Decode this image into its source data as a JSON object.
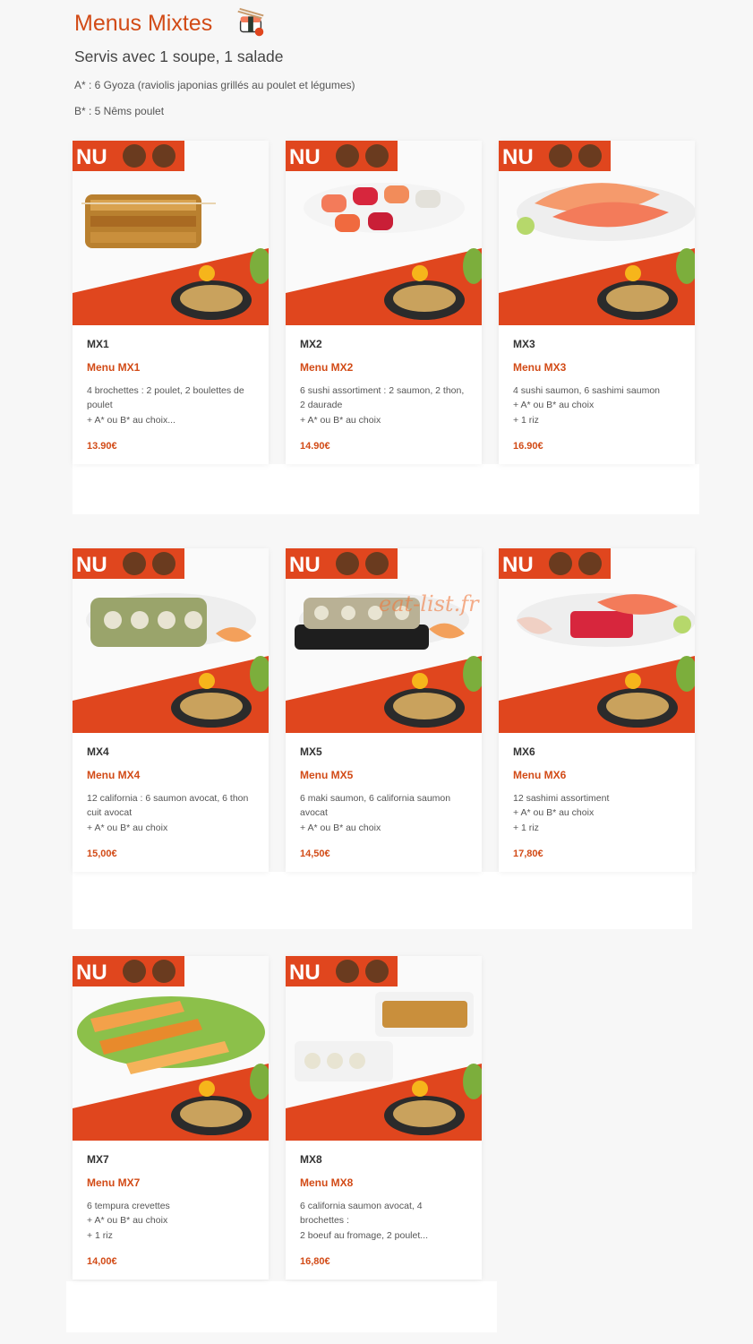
{
  "header": {
    "title": "Menus Mixtes",
    "subtitle": "Servis avec 1 soupe, 1 salade",
    "notes": [
      "A* : 6 Gyoza (raviolis japonias grillés au poulet et légumes)",
      "B* : 5 Nêms poulet"
    ],
    "icon": "sushi-icon"
  },
  "brand_badge": "NU",
  "colors": {
    "accent": "#d24b17",
    "background": "#f7f7f7",
    "card": "#ffffff",
    "banner_red": "#e0461e"
  },
  "menus": [
    {
      "code": "MX1",
      "name": "Menu MX1",
      "desc": [
        "4 brochettes : 2 poulet, 2 boulettes de poulet",
        "+ A* ou B* au choix..."
      ],
      "price": "13.90€",
      "food": "skewers-dish"
    },
    {
      "code": "MX2",
      "name": "Menu MX2",
      "desc": [
        "6 sushi assortiment : 2 saumon, 2 thon, 2 daurade",
        "+ A* ou B* au choix"
      ],
      "price": "14.90€",
      "food": "sushi-dish"
    },
    {
      "code": "MX3",
      "name": "Menu MX3",
      "desc": [
        "4 sushi saumon, 6 sashimi saumon",
        "+ A* ou B* au choix",
        "+ 1 riz"
      ],
      "price": "16.90€",
      "food": "salmon-dish"
    },
    {
      "code": "MX4",
      "name": "Menu MX4",
      "desc": [
        "12 california : 6 saumon avocat, 6 thon cuit avocat",
        "+ A* ou B* au choix"
      ],
      "price": "15,00€",
      "food": "california-dish"
    },
    {
      "code": "MX5",
      "name": "Menu MX5",
      "desc": [
        "6 maki saumon, 6 california saumon avocat",
        "+ A* ou B* au choix"
      ],
      "price": "14,50€",
      "food": "maki-dish"
    },
    {
      "code": "MX6",
      "name": "Menu MX6",
      "desc": [
        "12 sashimi assortiment",
        "+ A* ou B* au choix",
        "+ 1 riz"
      ],
      "price": "17,80€",
      "food": "sashimi-dish"
    },
    {
      "code": "MX7",
      "name": "Menu MX7",
      "desc": [
        "6 tempura crevettes",
        "+ A* ou B* au choix",
        "+ 1 riz"
      ],
      "price": "14,00€",
      "food": "tempura-dish"
    },
    {
      "code": "MX8",
      "name": "Menu MX8",
      "desc": [
        "6 california saumon avocat, 4 brochettes :",
        "2 boeuf au fromage, 2 poulet..."
      ],
      "price": "16,80€",
      "food": "mixed-dish"
    }
  ],
  "watermark": "eat-list.fr"
}
